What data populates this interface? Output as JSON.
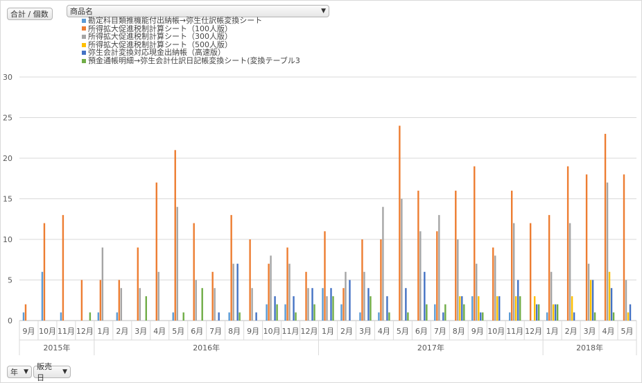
{
  "controls": {
    "values_button": "合計 / 個数",
    "product_button": "商品名",
    "year_button": "年",
    "date_button": "販売日"
  },
  "icons": {
    "dropdown": "chevron-down-icon"
  },
  "chart_data": {
    "type": "bar",
    "ylim": [
      0,
      30
    ],
    "yticks": [
      0,
      5,
      10,
      15,
      20,
      25,
      30
    ],
    "grid": true,
    "legend_position": "top-left",
    "years": [
      {
        "label": "2015年",
        "months": 4
      },
      {
        "label": "2016年",
        "months": 12
      },
      {
        "label": "2017年",
        "months": 12
      },
      {
        "label": "2018年",
        "months": 5
      }
    ],
    "categories": [
      "9月",
      "10月",
      "11月",
      "12月",
      "1月",
      "2月",
      "3月",
      "4月",
      "5月",
      "6月",
      "7月",
      "8月",
      "9月",
      "10月",
      "11月",
      "12月",
      "1月",
      "2月",
      "3月",
      "4月",
      "5月",
      "6月",
      "7月",
      "8月",
      "9月",
      "10月",
      "11月",
      "12月",
      "1月",
      "2月",
      "3月",
      "4月",
      "5月"
    ],
    "series": [
      {
        "name": "勘定科目類推機能付出納帳→弥生仕訳帳変換シート",
        "color": "#5b9bd5",
        "values": [
          1,
          6,
          1,
          0,
          1,
          1,
          0,
          0,
          1,
          0,
          0,
          1,
          0,
          2,
          2,
          0,
          4,
          2,
          1,
          1,
          0,
          0,
          2,
          0,
          3,
          0,
          1,
          0,
          1,
          0,
          0,
          0,
          0
        ]
      },
      {
        "name": "所得拡大促進税制計算シート（100人版）",
        "color": "#ed7d31",
        "values": [
          2,
          12,
          13,
          5,
          5,
          5,
          9,
          17,
          21,
          12,
          6,
          13,
          10,
          7,
          9,
          6,
          11,
          4,
          10,
          10,
          24,
          16,
          11,
          16,
          19,
          9,
          16,
          12,
          13,
          19,
          18,
          23,
          18
        ]
      },
      {
        "name": "所得拡大促進税制計算シート（300人版）",
        "color": "#a5a5a5",
        "values": [
          0,
          0,
          0,
          0,
          9,
          4,
          4,
          6,
          14,
          5,
          4,
          7,
          4,
          8,
          7,
          4,
          3,
          6,
          6,
          14,
          15,
          11,
          13,
          10,
          7,
          8,
          12,
          0,
          6,
          12,
          7,
          17,
          5
        ]
      },
      {
        "name": "所得拡大促進税制計算シート（500人版）",
        "color": "#ffc000",
        "values": [
          0,
          0,
          0,
          0,
          0,
          0,
          0,
          0,
          0,
          0,
          0,
          0,
          0,
          0,
          0,
          0,
          0,
          0,
          0,
          0,
          0,
          0,
          0,
          3,
          3,
          3,
          3,
          3,
          2,
          3,
          5,
          6,
          1
        ]
      },
      {
        "name": "弥生会計変換対応現金出納帳（高速版）",
        "color": "#4472c4",
        "values": [
          0,
          0,
          0,
          0,
          0,
          0,
          0,
          0,
          0,
          0,
          1,
          7,
          1,
          3,
          3,
          4,
          4,
          5,
          4,
          3,
          4,
          6,
          1,
          3,
          1,
          3,
          5,
          2,
          2,
          1,
          5,
          4,
          2
        ]
      },
      {
        "name": "預金通帳明細→弥生会計仕訳日記帳変換シート(変換テーブル3",
        "color": "#70ad47",
        "values": [
          0,
          0,
          0,
          1,
          0,
          0,
          3,
          0,
          1,
          4,
          0,
          1,
          0,
          2,
          1,
          2,
          3,
          0,
          3,
          1,
          1,
          2,
          2,
          2,
          1,
          0,
          3,
          2,
          2,
          0,
          1,
          1,
          0
        ]
      }
    ]
  }
}
